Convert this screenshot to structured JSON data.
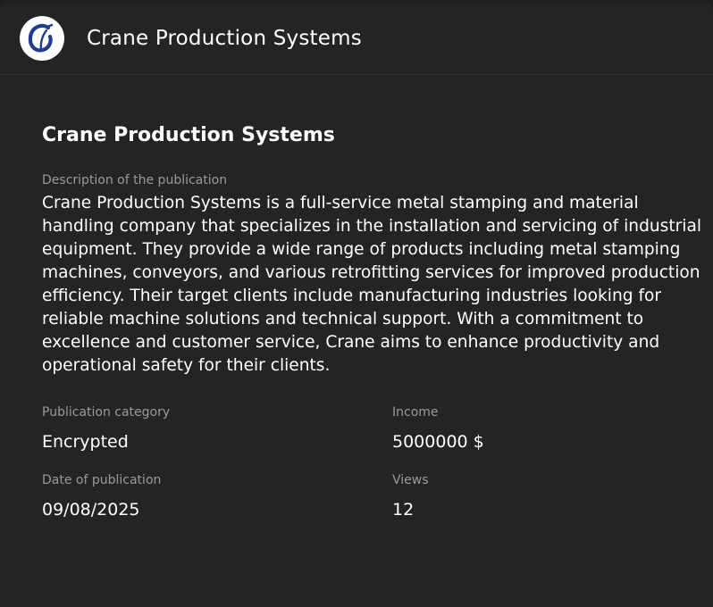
{
  "header": {
    "title": "Crane Production Systems",
    "logo_icon": "crane-logo-icon",
    "logo_letter": "C"
  },
  "publication": {
    "title": "Crane Production Systems",
    "description_label": "Description of the publication",
    "description": "Crane Production Systems is a full-service metal stamping and material handling company that specializes in the installation and servicing of industrial equipment. They provide a wide range of products including metal stamping machines, conveyors, and various retrofitting services for improved production efficiency. Their target clients include manufacturing industries looking for reliable machine solutions and technical support. With a commitment to excellence and customer service, Crane aims to enhance productivity and operational safety for their clients.",
    "fields": {
      "category_label": "Publication category",
      "category_value": "Encrypted",
      "income_label": "Income",
      "income_value": "5000000 $",
      "date_label": "Date of publication",
      "date_value": "09/08/2025",
      "views_label": "Views",
      "views_value": "12"
    }
  },
  "colors": {
    "background": "#1f1f1f",
    "card": "#242424",
    "text": "#ffffff",
    "muted": "#9a9a9a",
    "logo_blue": "#1e3f8f"
  }
}
